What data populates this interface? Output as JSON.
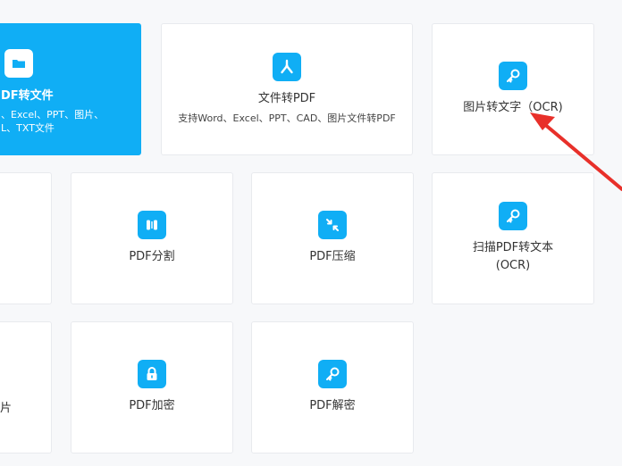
{
  "cards": {
    "file_to_pdf": {
      "title": "文件转PDF",
      "desc": "支持Word、Excel、PPT、CAD、图片文件转PDF",
      "icon": "pdf-logo-icon"
    },
    "image_to_text": {
      "title": "图片转文字（OCR)",
      "icon": "key-icon"
    },
    "pdf_split": {
      "title": "PDF分割",
      "icon": "split-icon"
    },
    "pdf_compress": {
      "title": "PDF压缩",
      "icon": "compress-arrows-icon"
    },
    "scan_pdf_ocr": {
      "title": "扫描PDF转文本",
      "subtitle": "(OCR)",
      "icon": "key-icon"
    },
    "pdf_encrypt": {
      "title": "PDF加密",
      "icon": "lock-icon"
    },
    "pdf_decrypt": {
      "title": "PDF解密",
      "icon": "key-icon"
    }
  },
  "partial": {
    "pdf_to_file_title": "DF转文件",
    "pdf_to_file_desc_line1": "、Excel、PPT、图片、",
    "pdf_to_file_desc_line2": "L、TXT文件",
    "left_fragment": "片"
  },
  "colors": {
    "accent": "#10aef5",
    "arrow": "#e8302a",
    "background": "#f7f8fa",
    "card": "#ffffff"
  }
}
